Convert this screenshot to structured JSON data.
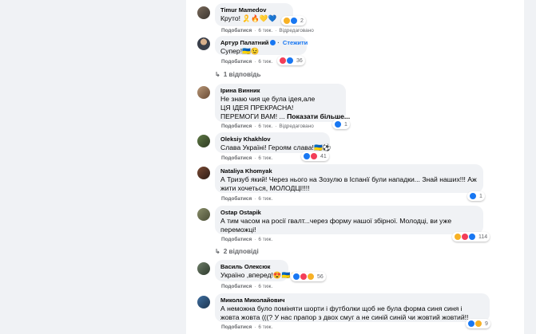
{
  "comments": [
    {
      "author": "Timur Mamedov",
      "text": "Круто! 🎗️🔥💛💙",
      "like": "Подобатися",
      "time": "6 тиж.",
      "edited": "Відредаговано",
      "reaction_count": "2",
      "reactions": [
        "haha",
        "like"
      ]
    },
    {
      "author": "Артур Палатний",
      "verified": true,
      "follow": "Стежити",
      "text": "Супер!🇺🇦😉",
      "like": "Подобатися",
      "time": "6 тиж.",
      "reaction_count": "36",
      "reactions": [
        "love",
        "like"
      ],
      "replies": "1 відповідь"
    },
    {
      "author": "Ірина Винник",
      "text_lines": [
        "Не знаю чия це була ідея,але",
        "ЦЯ ІДЕЯ ПРЕКРАСНА!",
        "ПЕРЕМОГИ ВАМ! ..."
      ],
      "see_more": "Показати більше...",
      "like": "Подобатися",
      "time": "6 тиж.",
      "edited": "Відредаговано",
      "reaction_count": "1",
      "reactions": [
        "like"
      ]
    },
    {
      "author": "Oleksiy Khakhlov",
      "text": "Слава Україні! Героям слава!🇺🇦⚽",
      "like": "Подобатися",
      "time": "6 тиж.",
      "reaction_count": "41",
      "reactions": [
        "like",
        "love"
      ]
    },
    {
      "author": "Nataliya Khomyak",
      "text_lines": [
        "А Тризуб який! Через нього на Зозулю в Іспанії були нападки... Знай наших!!! Аж",
        "жити хочеться, МОЛОДЦІ!!!!"
      ],
      "like": "Подобатися",
      "time": "6 тиж.",
      "reaction_count": "1",
      "reactions": [
        "like"
      ]
    },
    {
      "author": "Ostap Ostapik",
      "text_lines": [
        "А тим часом на росії гвалт...через форму нашої збірної. Молодці, ви уже",
        "переможці!"
      ],
      "like": "Подобатися",
      "time": "6 тиж.",
      "reaction_count": "114",
      "reactions": [
        "haha",
        "love",
        "like"
      ],
      "replies": "2 відповіді"
    },
    {
      "author": "Василь Олексюк",
      "text": "Україно ,вперед!😍🇺🇦👏",
      "like": "Подобатися",
      "time": "6 тиж.",
      "reaction_count": "56",
      "reactions": [
        "like",
        "love",
        "haha"
      ]
    },
    {
      "author": "Микола Миколайович",
      "text_lines": [
        "А неможна було поміняти шорти і футболки щоб не була форма синя синя і",
        "жовта жовта (((? У нас прапор з двох смуг а не синій синій чи жовтий жовтий!!"
      ],
      "like": "Подобатися",
      "time": "6 тиж.",
      "reaction_count": "9",
      "reactions": [
        "like",
        "haha"
      ]
    }
  ],
  "colors": {
    "bubble": "#f0f2f5",
    "meta": "#65676b",
    "link": "#1877f2",
    "text": "#050505"
  }
}
